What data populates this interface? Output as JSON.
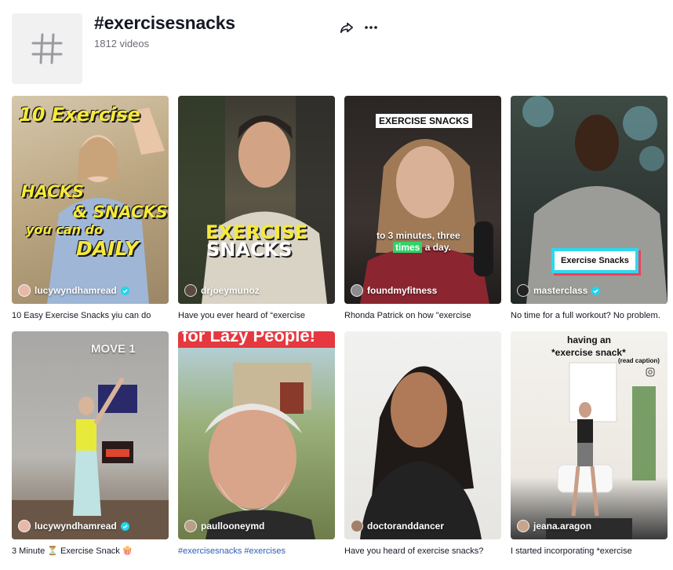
{
  "tag": {
    "title": "#exercisesnacks",
    "count": "1812 videos",
    "share_icon": "share-icon",
    "more_icon": "more-icon"
  },
  "videos": [
    {
      "author": "lucywyndhamread",
      "verified": true,
      "caption": "10 Easy Exercise Snacks yiu can do",
      "overlay": [
        "10 Exercise",
        "HACKS",
        "& SNACKS",
        "you can do",
        "DAILY"
      ]
    },
    {
      "author": "drjoeymunoz",
      "verified": false,
      "caption": "Have you ever heard of “exercise",
      "overlay": [
        "EXERCISE",
        "SNACKS"
      ]
    },
    {
      "author": "foundmyfitness",
      "verified": false,
      "caption": "Rhonda Patrick on how \"exercise",
      "overlay": [
        "EXERCISE SNACKS",
        "to 3 minutes, three",
        "times",
        "a day."
      ]
    },
    {
      "author": "masterclass",
      "verified": true,
      "caption": "No time for a full workout? No problem.",
      "overlay": [
        "Exercise Snacks"
      ]
    },
    {
      "author": "lucywyndhamread",
      "verified": true,
      "caption": "3 Minute ⏳ Exercise Snack 🍿",
      "overlay": [
        "MOVE 1"
      ]
    },
    {
      "author": "paullooneymd",
      "verified": false,
      "caption": "#exercisesnacks #exercises",
      "overlay": [
        "for Lazy People!"
      ]
    },
    {
      "author": "doctoranddancer",
      "verified": false,
      "caption": "Have you heard of exercise snacks?",
      "overlay": []
    },
    {
      "author": "jeana.aragon",
      "verified": false,
      "caption": "I started incorporating *exercise",
      "overlay": [
        "having an",
        "*exercise snack*",
        "(read caption)"
      ]
    }
  ],
  "colors": {
    "accent_link": "#2b5db9",
    "verified": "#20d5ec",
    "text_primary": "#161823",
    "text_secondary": "#6b6d74"
  }
}
